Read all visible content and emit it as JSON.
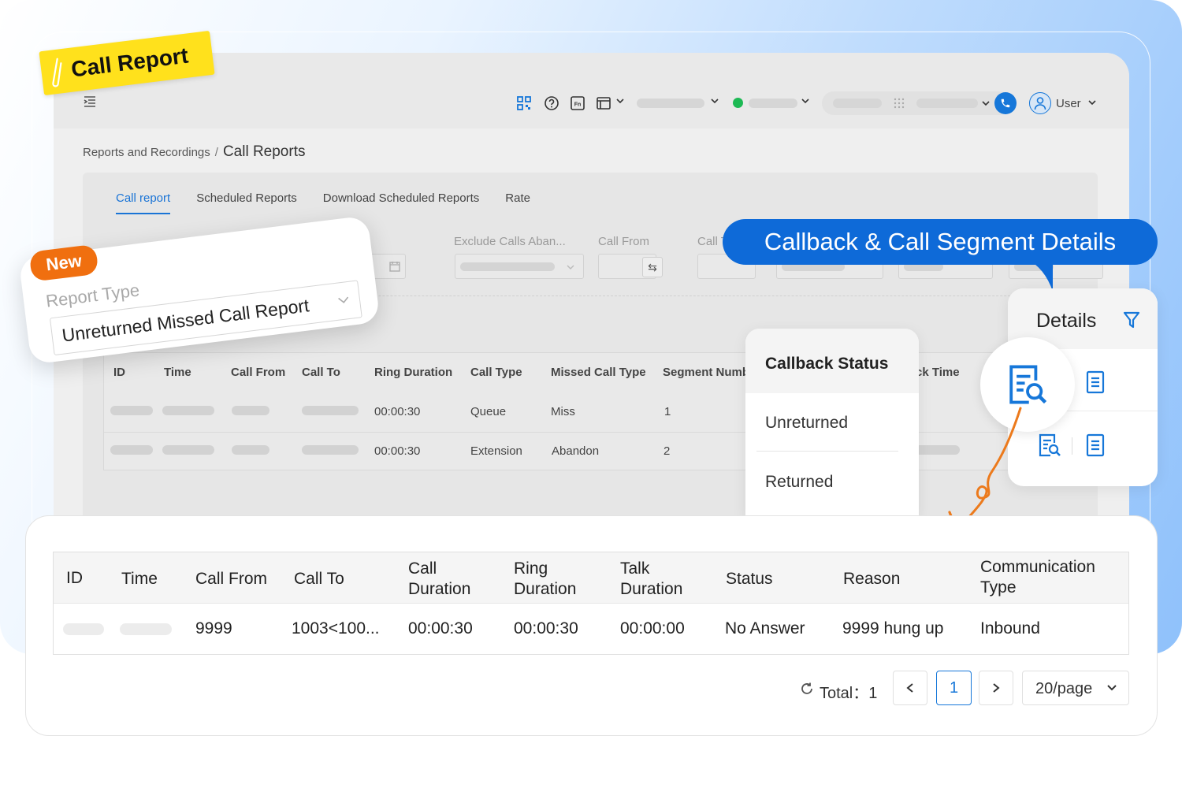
{
  "sticker": {
    "text": "Call Report"
  },
  "header": {
    "user_label": "User"
  },
  "breadcrumb": {
    "parent": "Reports and Recordings",
    "separator": "/",
    "current": "Call Reports"
  },
  "tabs": [
    {
      "label": "Call report",
      "active": true
    },
    {
      "label": "Scheduled Reports",
      "active": false
    },
    {
      "label": "Download Scheduled Reports",
      "active": false
    },
    {
      "label": "Rate",
      "active": false
    }
  ],
  "filters": {
    "exclude_label": "Exclude Calls Aban...",
    "call_from_label": "Call From",
    "call_to_label": "Call To"
  },
  "background_table": {
    "headers": [
      "ID",
      "Time",
      "Call From",
      "Call To",
      "Ring Duration",
      "Call Type",
      "Missed Call Type",
      "Segment Numb",
      "ck Time"
    ],
    "rows": [
      {
        "ring_duration": "00:00:30",
        "call_type": "Queue",
        "missed_call_type": "Miss",
        "segment_number": "1"
      },
      {
        "ring_duration": "00:00:30",
        "call_type": "Extension",
        "missed_call_type": "Abandon",
        "segment_number": "2"
      }
    ]
  },
  "new_card": {
    "badge": "New",
    "label": "Report Type",
    "value": "Unreturned Missed Call Report"
  },
  "callback_tag": {
    "text": "Callback & Call Segment Details"
  },
  "callback_status": {
    "title": "Callback Status",
    "options": [
      "Unreturned",
      "Returned"
    ]
  },
  "details_panel": {
    "title": "Details"
  },
  "detail_table": {
    "headers": {
      "id": "ID",
      "time": "Time",
      "call_from": "Call From",
      "call_to": "Call To",
      "call_duration": [
        "Call",
        "Duration"
      ],
      "ring_duration": [
        "Ring",
        "Duration"
      ],
      "talk_duration": [
        "Talk",
        "Duration"
      ],
      "status": "Status",
      "reason": "Reason",
      "communication_type": [
        "Communication",
        "Type"
      ]
    },
    "row": {
      "call_from": "9999",
      "call_to": "1003<100...",
      "call_duration": "00:00:30",
      "ring_duration": "00:00:30",
      "talk_duration": "00:00:00",
      "status": "No Answer",
      "reason": "9999 hung up",
      "communication_type": "Inbound"
    }
  },
  "pagination": {
    "total": "Total：1",
    "current_page": "1",
    "page_size": "20/page"
  },
  "colors": {
    "accent": "#1677d9",
    "callback_tag": "#0e6ad8",
    "new_badge": "#f06f0f",
    "sticker": "#ffe11c",
    "status_online": "#1db954"
  }
}
